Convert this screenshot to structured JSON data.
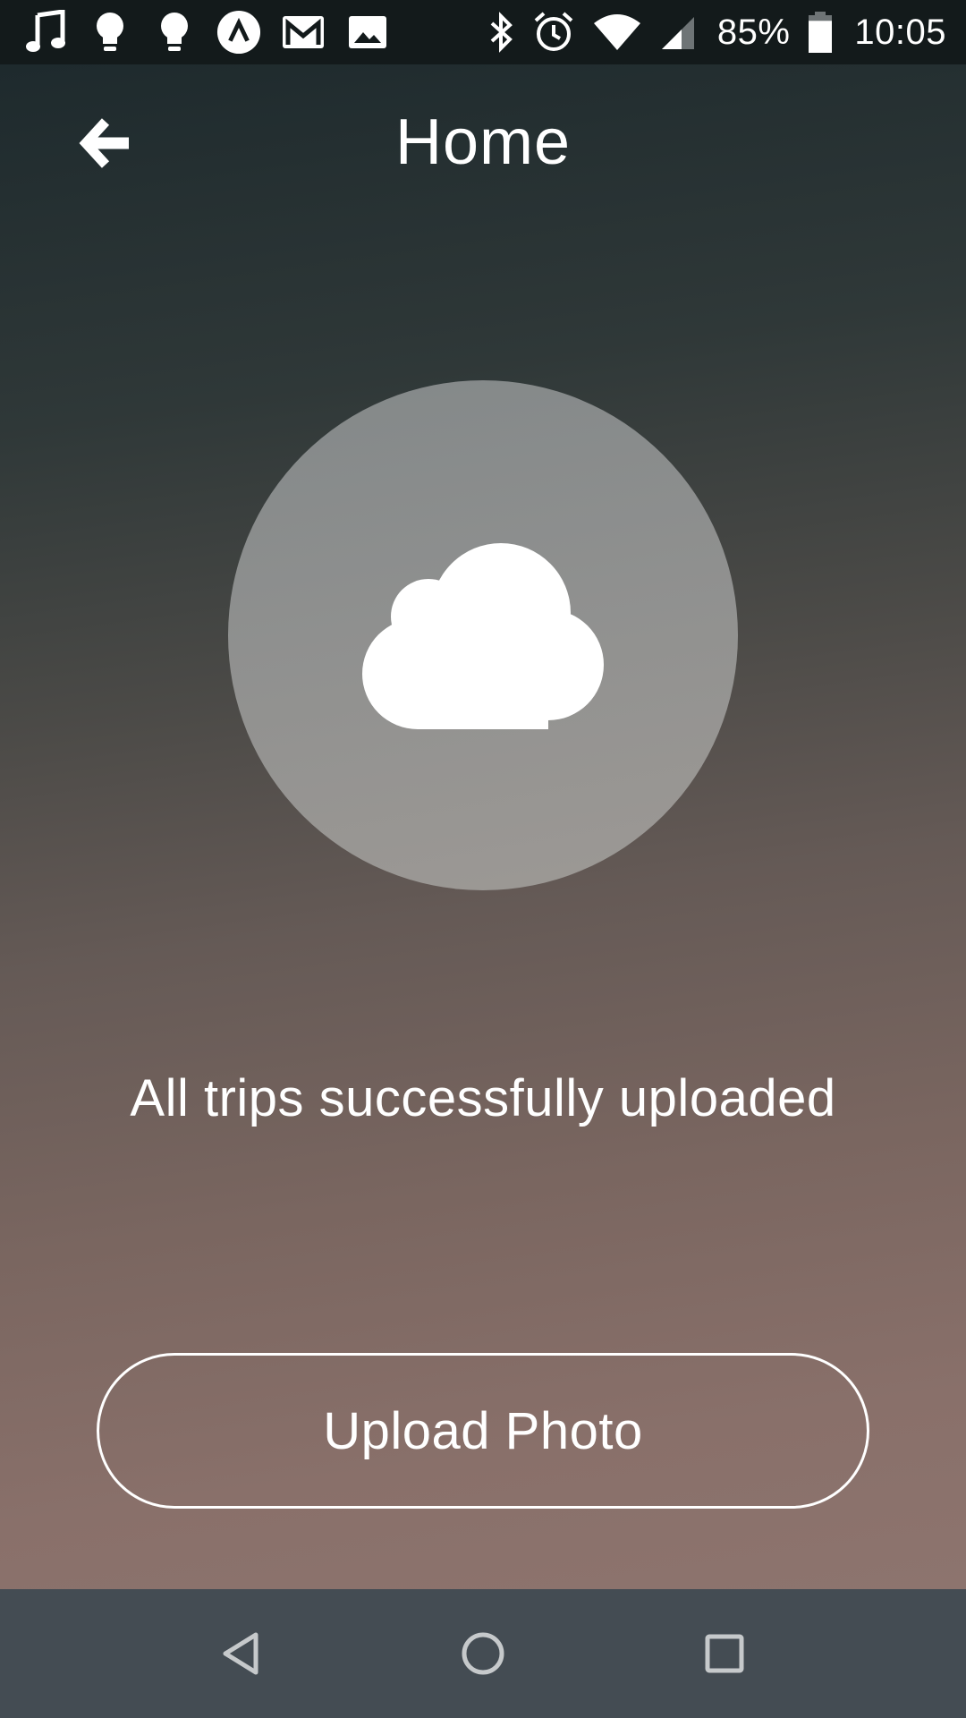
{
  "status_bar": {
    "left_icons": [
      "music-note-icon",
      "lightbulb-icon",
      "lightbulb-icon",
      "app-a-icon",
      "gmail-icon",
      "image-icon"
    ],
    "right_icons": [
      "bluetooth-icon",
      "alarm-icon",
      "wifi-icon",
      "cellular-signal-icon"
    ],
    "battery_percent": "85%",
    "battery_level": 0.85,
    "time": "10:05"
  },
  "header": {
    "back_icon": "back-arrow-icon",
    "title": "Home"
  },
  "main": {
    "status_icon": "cloud-icon",
    "message": "All trips successfully uploaded",
    "upload_button_label": "Upload Photo"
  },
  "nav_bar": {
    "buttons": [
      "back-triangle-icon",
      "home-circle-icon",
      "recents-square-icon"
    ]
  },
  "colors": {
    "status_bar_bg": "#131a1b",
    "nav_bar_bg": "#444c53",
    "gradient_top": "#1e2a2d",
    "gradient_bottom": "#8d746e",
    "circle_fill": "#8f908f",
    "text": "#ffffff"
  }
}
